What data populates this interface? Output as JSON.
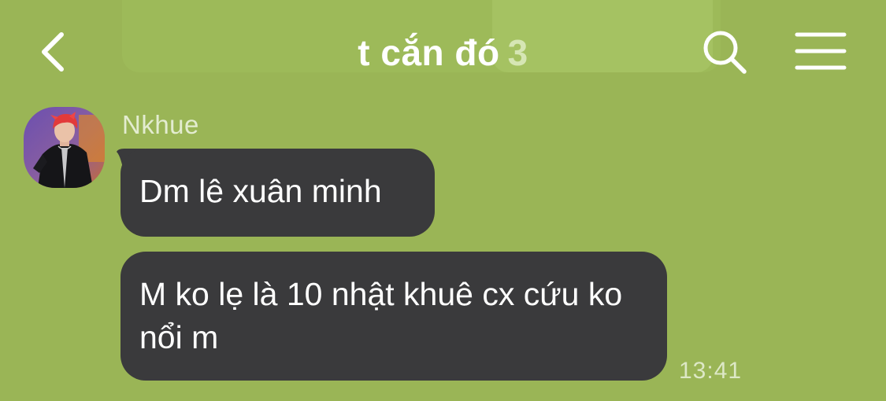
{
  "header": {
    "title": "t cắn đó",
    "member_count": "3",
    "back_icon": "chevron-left-icon",
    "search_icon": "search-icon",
    "menu_icon": "hamburger-menu-icon"
  },
  "colors": {
    "background": "#9ab556",
    "bubble": "#3a3a3c",
    "title_text": "#ffffff",
    "meta_text": "#dde8c6"
  },
  "messages": [
    {
      "sender": "Nkhue",
      "text": "Dm lê xuân minh"
    },
    {
      "text": "M ko lẹ là 10 nhật khuê cx cứu ko nổi m",
      "time": "13:41"
    }
  ]
}
